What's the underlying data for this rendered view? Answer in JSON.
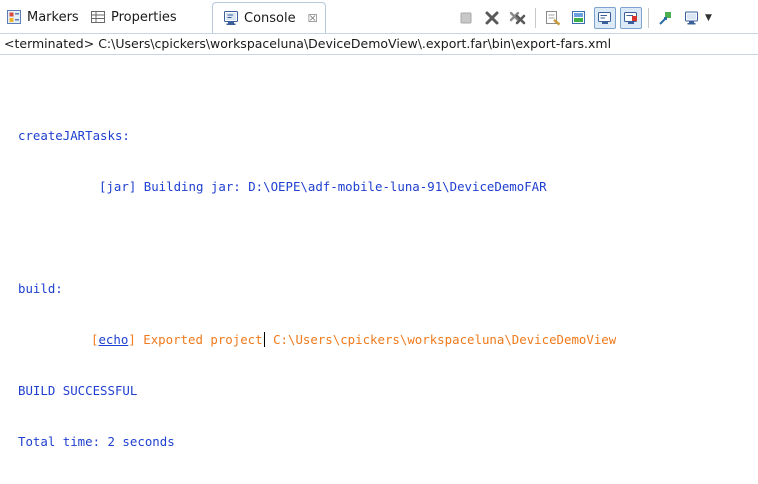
{
  "tabs": [
    {
      "label": "Markers",
      "icon": "markers-icon"
    },
    {
      "label": "Properties",
      "icon": "properties-icon"
    },
    {
      "label": "Console",
      "icon": "console-icon",
      "active": true,
      "close_glyph": "☒"
    }
  ],
  "toolbar": {
    "buttons": [
      {
        "name": "terminate",
        "icon": "terminate-icon"
      },
      {
        "name": "remove-launch",
        "icon": "remove-launch-icon"
      },
      {
        "name": "remove-all-terminated",
        "icon": "remove-all-terminated-icon"
      },
      {
        "name": "clear-console",
        "icon": "clear-console-icon"
      },
      {
        "name": "scroll-lock",
        "icon": "scroll-lock-icon"
      },
      {
        "name": "show-on-stdout",
        "icon": "show-stdout-icon",
        "pressed": true
      },
      {
        "name": "show-on-stderr",
        "icon": "show-stderr-icon",
        "pressed": true
      },
      {
        "name": "pin-console",
        "icon": "pin-icon"
      },
      {
        "name": "display-selected-console",
        "icon": "display-console-icon"
      }
    ],
    "menu_glyph": "▼"
  },
  "description": "<terminated> C:\\Users\\cpickers\\workspaceluna\\DeviceDemoView\\.export.far\\bin\\export-fars.xml",
  "output": {
    "target1": "createJARTasks:",
    "jar_line": "[jar] Building jar: D:\\OEPE\\adf-mobile-luna-91\\DeviceDemoFAR",
    "target2": "build:",
    "echo_open": "[",
    "echo_link": "echo",
    "echo_close": "]",
    "echo_msg_a": " Exported project",
    "echo_msg_b": " C:\\Users\\cpickers\\workspaceluna\\DeviceDemoView",
    "build_result": "BUILD SUCCESSFUL",
    "total_time": "Total time: 2 seconds"
  },
  "colors": {
    "stdout_blue": "#1f3fd0",
    "echo_orange": "#f07a1c",
    "tab_border": "#b5c8dc"
  }
}
